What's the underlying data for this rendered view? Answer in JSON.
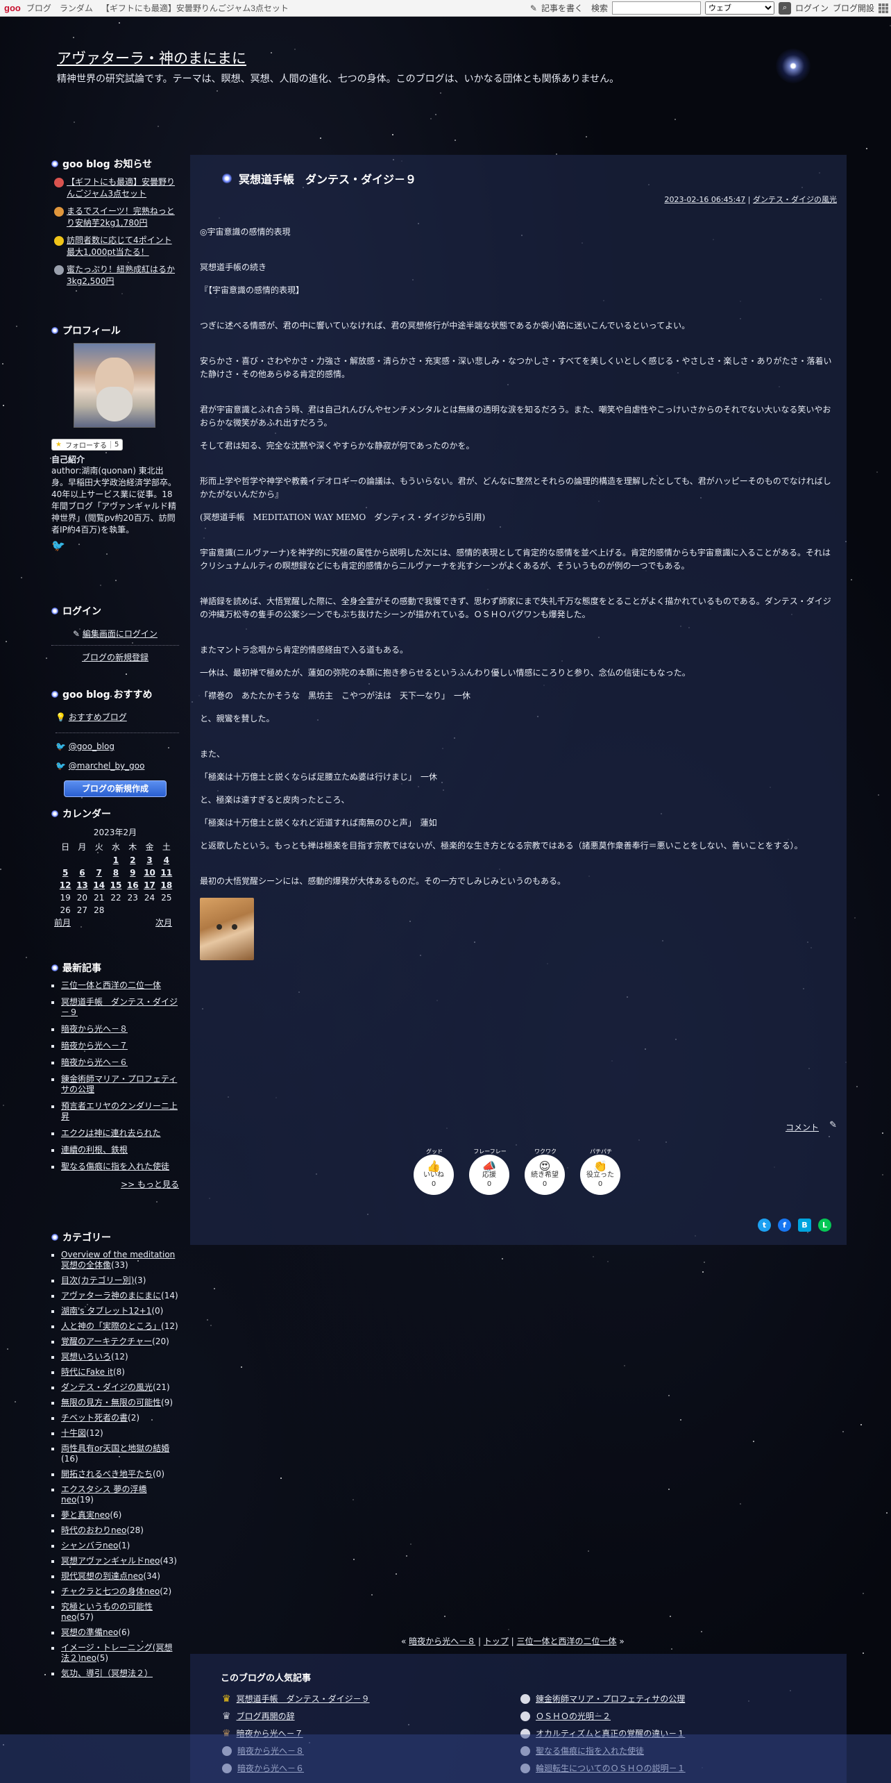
{
  "topbar": {
    "logo": "goo",
    "links": [
      "ブログ",
      "ランダム",
      "【ギフトにも最適】安曇野りんごジャム3点セット"
    ],
    "write": "記事を書く",
    "search_label": "検索",
    "search_placeholder": "",
    "web_option": "ウェブ",
    "login": "ログイン",
    "open_blog": "ブログ開設"
  },
  "header": {
    "title": "アヴァターラ・神のまにまに",
    "description": "精神世界の研究試論です。テーマは、瞑想、冥想、人間の進化、七つの身体。このブログは、いかなる団体とも関係ありません。"
  },
  "sidebar": {
    "notice_title": "goo blog お知らせ",
    "notices": [
      {
        "text": "【ギフトにも最適】安曇野りんごジャム3点セット",
        "color": "#d9534f"
      },
      {
        "text": "まるでスイーツ！完熟ねっとり安納芋2kg1,780円",
        "color": "#e0963c"
      },
      {
        "text": "訪問者数に応じて4ポイント最大1,000pt当たる！",
        "color": "#f0c419"
      },
      {
        "text": "蜜たっぷり！紐熟成紅はるか3kg2,500円",
        "color": "#9aa0ad"
      }
    ],
    "profile_title": "プロフィール",
    "follow_label": "フォローする",
    "follow_count": "5",
    "self_intro_title": "自己紹介",
    "self_intro": "author:湖南(quonan) 東北出身。早稲田大学政治経済学部卒。40年以上サービス業に従事。18年間ブログ「アヴァンギャルド精神世界」(閲覧pv約20百万、訪問者IP約4百万)を執筆。",
    "login_title": "ログイン",
    "login_link": "編集画面にログイン",
    "register_link": "ブログの新規登録",
    "recommend_title": "goo blog おすすめ",
    "recommend_link": "おすすめブログ",
    "twitter_links": [
      "@goo_blog",
      "@marchel_by_goo"
    ],
    "new_blog_button": "ブログの新規作成",
    "calendar_title": "カレンダー",
    "calendar_month": "2023年2月",
    "weekdays": [
      "日",
      "月",
      "火",
      "水",
      "木",
      "金",
      "土"
    ],
    "calendar_rows": [
      [
        "",
        "",
        "",
        "1",
        "2",
        "3",
        "4"
      ],
      [
        "5",
        "6",
        "7",
        "8",
        "9",
        "10",
        "11"
      ],
      [
        "12",
        "13",
        "14",
        "15",
        "16",
        "17",
        "18"
      ],
      [
        "19",
        "20",
        "21",
        "22",
        "23",
        "24",
        "25"
      ],
      [
        "26",
        "27",
        "28",
        "",
        "",
        "",
        ""
      ]
    ],
    "prev_month": "前月",
    "next_month": "次月",
    "recent_title": "最新記事",
    "recent": [
      "三位一体と西洋の二位一体",
      "冥想道手帳　ダンテス・ダイジ－９",
      "暗夜から光へ－８",
      "暗夜から光へ－７",
      "暗夜から光へ－６",
      "錬金術師マリア・プロフェティサの公理",
      "預言者エリヤのクンダリーニ上昇",
      "エククは神に連れ去られた",
      "連續の利根、鉄根",
      "聖なる傷痕に指を入れた使徒"
    ],
    "more": ">> もっと見る",
    "category_title": "カテゴリー",
    "categories": [
      {
        "name": "Overview of the meditation 冥想の全体像",
        "count": "(33)"
      },
      {
        "name": "目次(カテゴリー別)",
        "count": "(3)"
      },
      {
        "name": "アヴァターラ神のまにまに",
        "count": "(14)"
      },
      {
        "name": "湖南's タブレット12+1",
        "count": "(0)"
      },
      {
        "name": "人と神の「実際のところ」",
        "count": "(12)"
      },
      {
        "name": "覚醒のアーキテクチャー",
        "count": "(20)"
      },
      {
        "name": "冥想いろいろ",
        "count": "(12)"
      },
      {
        "name": "時代にFake it",
        "count": "(8)"
      },
      {
        "name": "ダンテス・ダイジの風光",
        "count": "(21)"
      },
      {
        "name": "無限の見方・無限の可能性",
        "count": "(9)"
      },
      {
        "name": "チベット死者の書",
        "count": "(2)"
      },
      {
        "name": "十牛図",
        "count": "(12)"
      },
      {
        "name": "両性具有or天国と地獄の結婚",
        "count": "(16)"
      },
      {
        "name": "開拓されるべき地平たち",
        "count": "(0)"
      },
      {
        "name": "エクスタシス 夢の浮橋neo",
        "count": "(19)"
      },
      {
        "name": "夢と真実neo",
        "count": "(6)"
      },
      {
        "name": "時代のおわりneo",
        "count": "(28)"
      },
      {
        "name": "シャンバラneo",
        "count": "(1)"
      },
      {
        "name": "冥想アヴァンギャルドneo",
        "count": "(43)"
      },
      {
        "name": "現代冥想の到達点neo",
        "count": "(34)"
      },
      {
        "name": "チャクラと七つの身体neo",
        "count": "(2)"
      },
      {
        "name": "究極というものの可能性neo",
        "count": "(57)"
      },
      {
        "name": "冥想の準備neo",
        "count": "(6)"
      },
      {
        "name": "イメージ・トレーニング(冥想法２)neo",
        "count": "(5)"
      },
      {
        "name": "気功、導引（冥想法２）",
        "count": ""
      }
    ]
  },
  "post": {
    "title": "冥想道手帳　ダンテス・ダイジ－９",
    "date": "2023-02-16 06:45:47",
    "category": "ダンテス・ダイジの風光",
    "paragraphs": [
      "◎宇宙意識の感情的表現",
      "",
      "冥想道手帳の続き",
      "『【宇宙意識の感情的表現】",
      "",
      "つぎに述べる情感が、君の中に響いていなければ、君の冥想修行が中途半端な状態であるか袋小路に迷いこんでいるといってよい。",
      "",
      "安らかさ・喜び・さわやかさ・力強さ・解放感・清らかさ・充実感・深い悲しみ・なつかしさ・すべてを美しくいとしく感じる・やさしさ・楽しさ・ありがたさ・落着いた静けさ・その他あらゆる肯定的感情。",
      "",
      "君が宇宙意識とふれ合う時、君は自己れんびんやセンチメンタルとは無縁の透明な涙を知るだろう。また、嘲笑や自虐性やこっけいさからのそれでない大いなる笑いやおおらかな微笑があふれ出すだろう。",
      "そして君は知る、完全な沈黙や深くやすらかな静寂が何であったのかを。",
      "",
      "形而上学や哲学や神学や教義イデオロギーの論議は、もういらない。君が、どんなに整然とそれらの論理的構造を理解したとしても、君がハッピーそのものでなければしかたがないんだから』",
      "(冥想道手帳　MEDITATION WAY MEMO　ダンティス・ダイジから引用)",
      "",
      "宇宙意識(ニルヴァーナ)を神学的に究極の属性から説明した次には、感情的表現として肯定的な感情を並べ上げる。肯定的感情からも宇宙意識に入ることがある。それはクリシュナムルティの瞑想録などにも肯定的感情からニルヴァーナを兆すシーンがよくあるが、そういうものが例の一つでもある。",
      "",
      "禅語録を読めば、大悟覚醒した際に、全身全霊がその感動で我慢できず、思わず師家にまで失礼千万な態度をとることがよく描かれているものである。ダンテス・ダイジの沖縄万松寺の隻手の公案シーンでもぶち抜けたシーンが描かれている。ＯＳＨＯバグワンも爆発した。",
      "",
      "またマントラ念唱から肯定的情感経由で入る道もある。",
      "一休は、最初禅で極めたが、蓮如の弥陀の本願に抱き参らせるというふんわり優しい情感にころりと参り、念仏の信徒にもなった。",
      "「襟巻の　あたたかそうな　黒坊主　こやつが法は　天下一なり」　一休",
      "と、親鸞を賛した。",
      "",
      "また、",
      "「極楽は十万億土と説くならば足腰立たぬ婆は行けまじ」　一休",
      "と、極楽は遠すぎると皮肉ったところ、",
      "「極楽は十万億土と説くなれど近道すれば南無のひと声」　蓮如",
      "と返歌したという。もっとも禅は極楽を目指す宗教ではないが、極楽的な生き方となる宗教ではある（諸悪莫作衆善奉行＝悪いことをしない、善いことをする）。",
      "",
      "最初の大悟覚醒シーンには、感動的爆発が大体あるものだ。その一方でしみじみというのもある。"
    ],
    "comment": "コメント",
    "reactions": [
      {
        "top": "グッド",
        "label": "いいね",
        "count": "0",
        "emoji": "👍"
      },
      {
        "top": "フレーフレー",
        "label": "応援",
        "count": "0",
        "emoji": "📣"
      },
      {
        "top": "ワクワク",
        "label": "続き希望",
        "count": "0",
        "emoji": "😍"
      },
      {
        "top": "パチパチ",
        "label": "役立った",
        "count": "0",
        "emoji": "👏"
      }
    ]
  },
  "pager": {
    "prev": "暗夜から光へ－８",
    "top": "トップ",
    "next": "三位一体と西洋の二位一体"
  },
  "popular": {
    "title": "このブログの人気記事",
    "left": [
      "冥想道手帳　ダンテス・ダイジ－９",
      "ブログ再開の辞",
      "暗夜から光へ－７",
      "暗夜から光へ－８",
      "暗夜から光へ－６"
    ],
    "right": [
      "錬金術師マリア・プロフェティサの公理",
      "ＯＳＨＯの光明－２",
      "オカルティズムと真正の覚醒の違い－１",
      "聖なる傷痕に指を入れた使徒",
      "輪廻転生についてのＯＳＨＯの説明－１"
    ]
  }
}
